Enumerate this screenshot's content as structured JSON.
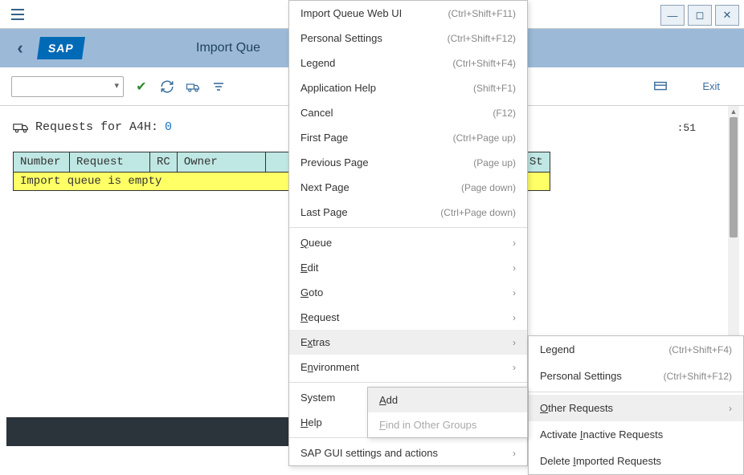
{
  "window": {
    "title": "Import Que"
  },
  "toolbar": {
    "exit_label": "Exit"
  },
  "content": {
    "requests_label_prefix": "Requests for A4H:",
    "requests_count": "0",
    "timestamp_suffix": ":51",
    "empty_message": "Import queue is empty"
  },
  "table": {
    "headers": {
      "number": "Number",
      "request": "Request",
      "rc": "RC",
      "owner": "Owner",
      "st": "St"
    }
  },
  "menu1": [
    {
      "label": "Import Queue Web UI",
      "shortcut": "(Ctrl+Shift+F11)"
    },
    {
      "label": "Personal Settings",
      "shortcut": "(Ctrl+Shift+F12)"
    },
    {
      "label": "Legend",
      "shortcut": "(Ctrl+Shift+F4)"
    },
    {
      "label": "Application Help",
      "shortcut": "(Shift+F1)"
    },
    {
      "label": "Cancel",
      "shortcut": "(F12)"
    },
    {
      "label": "First Page",
      "shortcut": "(Ctrl+Page up)"
    },
    {
      "label": "Previous Page",
      "shortcut": "(Page up)"
    },
    {
      "label": "Next Page",
      "shortcut": "(Page down)"
    },
    {
      "label": "Last Page",
      "shortcut": "(Ctrl+Page down)"
    },
    {
      "label": "Queue",
      "submenu": true,
      "underline": 0
    },
    {
      "label": "Edit",
      "submenu": true,
      "underline": 0
    },
    {
      "label": "Goto",
      "submenu": true,
      "underline": 0
    },
    {
      "label": "Request",
      "submenu": true,
      "underline": 0
    },
    {
      "label": "Extras",
      "submenu": true,
      "underline": 1,
      "hover": true
    },
    {
      "label": "Environment",
      "submenu": true,
      "underline": 1
    },
    {
      "label": "System",
      "submenu": true
    },
    {
      "label": "Help",
      "submenu": true,
      "underline": 0
    },
    {
      "label": "SAP GUI settings and actions",
      "submenu": true
    }
  ],
  "menu2": [
    {
      "label": "Legend",
      "shortcut": "(Ctrl+Shift+F4)"
    },
    {
      "label": "Personal Settings",
      "shortcut": "(Ctrl+Shift+F12)"
    },
    {
      "label": "Other Requests",
      "submenu": true,
      "underline": 0,
      "hover": true
    },
    {
      "label": "Activate Inactive Requests",
      "underline": 9
    },
    {
      "label": "Delete Imported Requests",
      "underline": 7
    }
  ],
  "menu3": [
    {
      "label": "Add",
      "hover": true,
      "underline": 0
    },
    {
      "label": "Find in Other Groups",
      "disabled": true,
      "underline": 0
    }
  ]
}
